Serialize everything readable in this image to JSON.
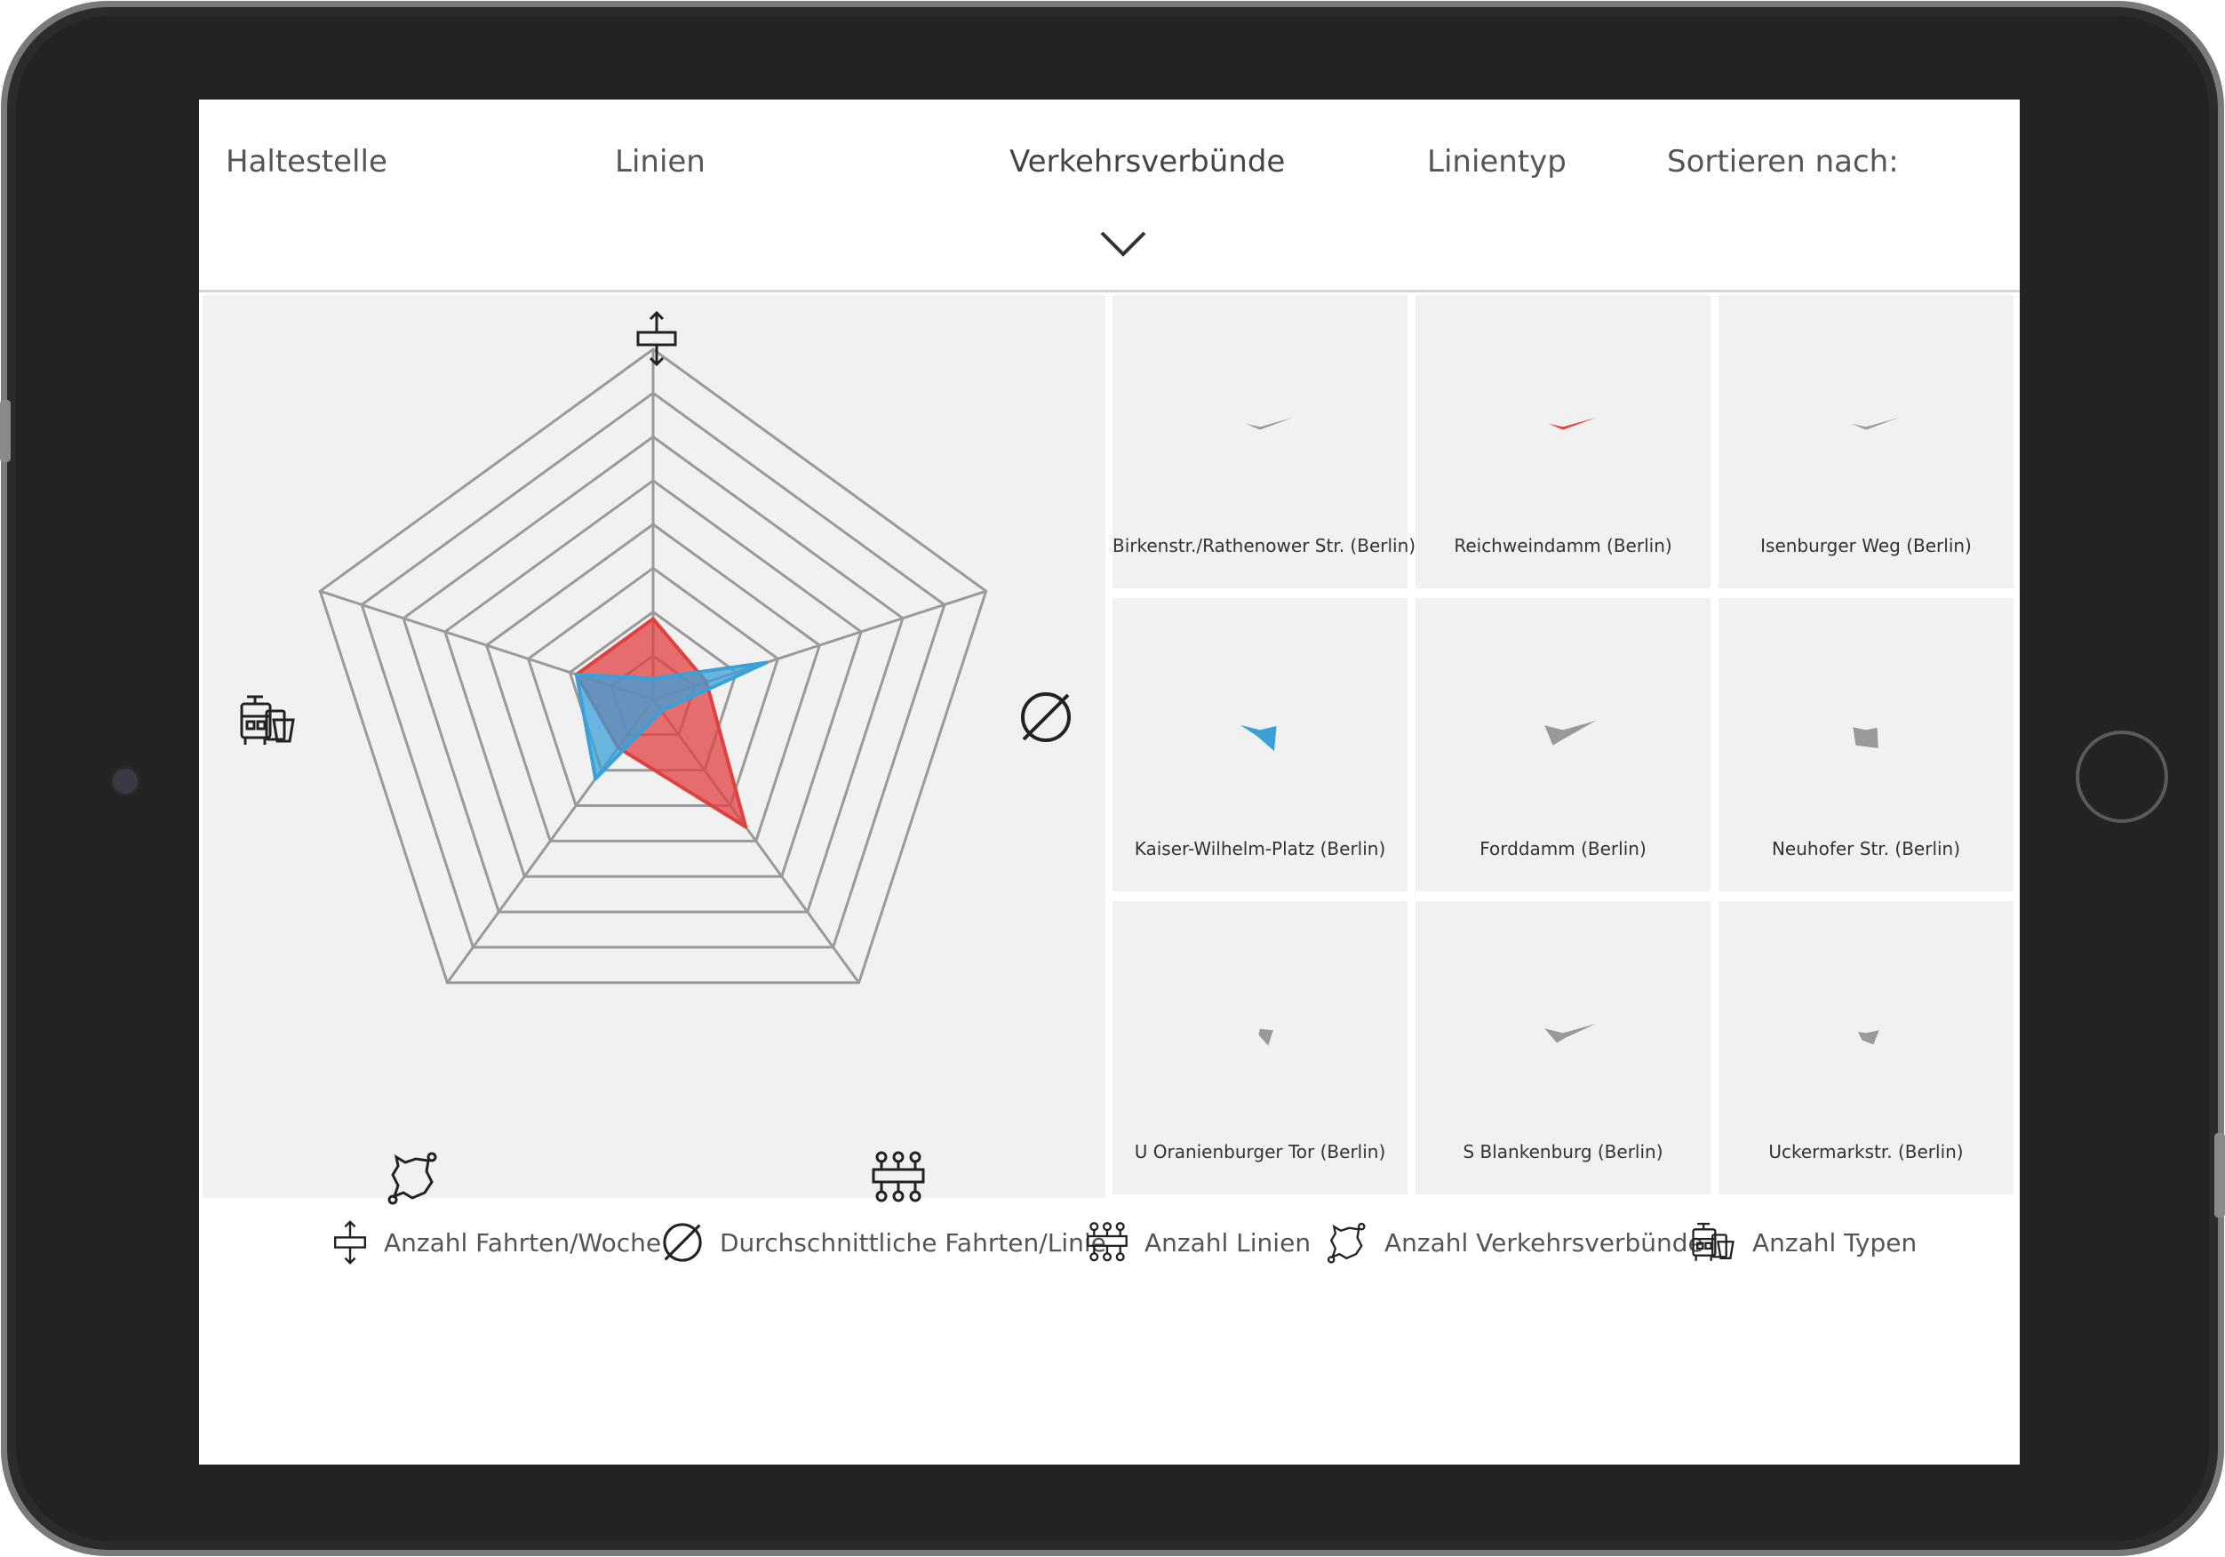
{
  "nav": {
    "items": [
      {
        "label": "Haltestelle"
      },
      {
        "label": "Linien"
      },
      {
        "label": "Verkehrsverbünde"
      },
      {
        "label": "Linientyp"
      },
      {
        "label": "Sortieren nach:"
      }
    ]
  },
  "legend": {
    "items": [
      {
        "label": "Anzahl Fahrten/Woche",
        "icon": "arrows-bar-icon"
      },
      {
        "label": "Durchschnittliche Fahrten/Linie",
        "icon": "diameter-icon"
      },
      {
        "label": "Anzahl Linien",
        "icon": "lines-network-icon"
      },
      {
        "label": "Anzahl Verkehrsverbünde",
        "icon": "region-map-icon"
      },
      {
        "label": "Anzahl Typen",
        "icon": "vehicles-icon"
      }
    ]
  },
  "chart_data": {
    "type": "radar",
    "axes": [
      "Anzahl Fahrten/Woche",
      "Durchschnittliche Fahrten/Linie",
      "Anzahl Linien",
      "Anzahl Verkehrsverbünde",
      "Anzahl Typen"
    ],
    "levels": 8,
    "range": [
      0,
      1
    ],
    "series": [
      {
        "color": "#e04040",
        "values": [
          0.23,
          0.16,
          0.45,
          0.17,
          0.23
        ]
      },
      {
        "color": "#3aa0d8",
        "values": [
          0.06,
          0.34,
          0.04,
          0.28,
          0.23
        ]
      }
    ]
  },
  "stations": [
    {
      "label": "Birkenstr./Rathenower Str. (Berlin)",
      "color": "#999999",
      "values": [
        0.02,
        0.5,
        0.02,
        0.02,
        0.22
      ]
    },
    {
      "label": "Reichweindamm (Berlin)",
      "color": "#e04040",
      "values": [
        0.02,
        0.5,
        0.02,
        0.02,
        0.22
      ]
    },
    {
      "label": "Isenburger Weg (Berlin)",
      "color": "#999999",
      "values": [
        0.02,
        0.5,
        0.02,
        0.02,
        0.22
      ]
    },
    {
      "label": "Kaiser-Wilhelm-Platz (Berlin)",
      "color": "#3aa0d8",
      "values": [
        0.02,
        0.25,
        0.35,
        0.08,
        0.3
      ]
    },
    {
      "label": "Forddamm (Berlin)",
      "color": "#999999",
      "values": [
        0.02,
        0.5,
        0.1,
        0.25,
        0.28
      ]
    },
    {
      "label": "Neuhofer Str. (Berlin)",
      "color": "#999999",
      "values": [
        0.02,
        0.17,
        0.3,
        0.25,
        0.2
      ]
    },
    {
      "label": "U Oranienburger Tor (Berlin)",
      "color": "#999999",
      "values": [
        0.08,
        0.2,
        0.2,
        0.02,
        0.02
      ]
    },
    {
      "label": "S Blankenburg (Berlin)",
      "color": "#999999",
      "values": [
        0.02,
        0.5,
        0.06,
        0.15,
        0.28
      ]
    },
    {
      "label": "Uckermarkstr. (Berlin)",
      "color": "#999999",
      "values": [
        0.02,
        0.2,
        0.18,
        0.1,
        0.12
      ]
    }
  ]
}
